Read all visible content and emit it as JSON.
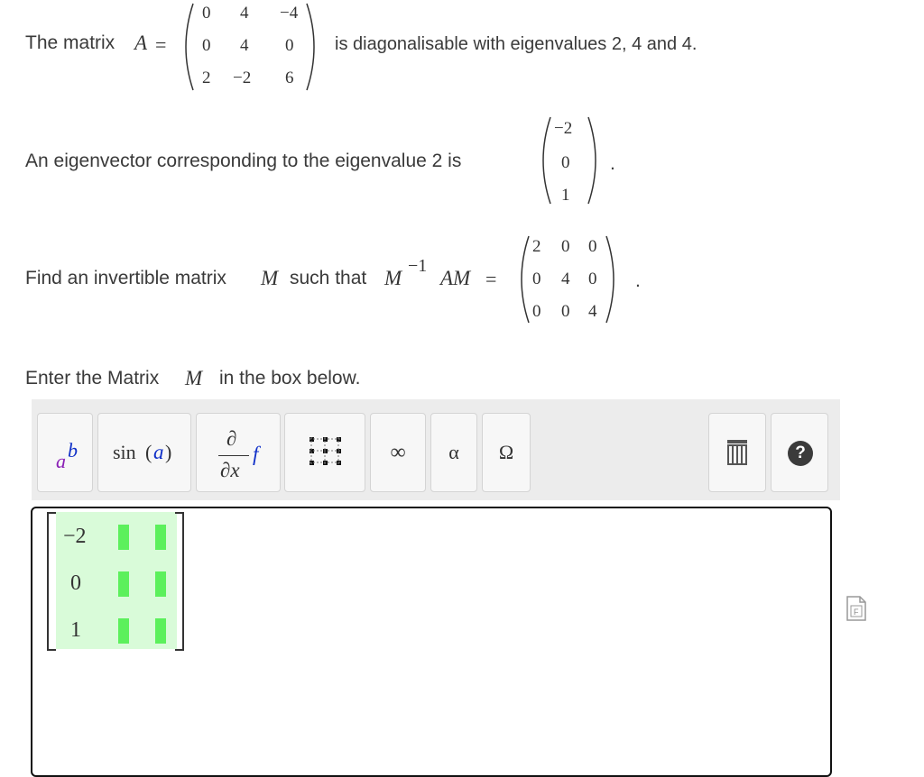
{
  "problem": {
    "line1_prefix": "The matrix",
    "matrix_symbol": "A",
    "equals": "=",
    "line1_suffix": "is diagonalisable with eigenvalues 2, 4 and 4.",
    "matrix_A": [
      [
        "0",
        "4",
        "−4"
      ],
      [
        "0",
        "4",
        "0"
      ],
      [
        "2",
        "−2",
        "6"
      ]
    ],
    "line2_text": "An eigenvector corresponding to the eigenvalue 2 is",
    "eigenvector": [
      "−2",
      "0",
      "1"
    ],
    "period": ".",
    "line3_prefix": "Find an invertible matrix",
    "line3_M": "M",
    "line3_mid": "such that",
    "line3_expr_M": "M",
    "line3_expr_sup": "−1",
    "line3_expr_AM": "AM",
    "line3_eq": "=",
    "diag_matrix": [
      [
        "2",
        "0",
        "0"
      ],
      [
        "0",
        "4",
        "0"
      ],
      [
        "0",
        "0",
        "4"
      ]
    ],
    "instruction_prefix": "Enter the Matrix",
    "instruction_M": "M",
    "instruction_suffix": "in the box below."
  },
  "toolbar": {
    "btn_power_base": "a",
    "btn_power_exp": "b",
    "btn_sin": "sin",
    "btn_sin_arg": "a",
    "btn_partial_num": "∂",
    "btn_partial_den": "∂x",
    "btn_partial_f": "f",
    "btn_infinity": "∞",
    "btn_alpha": "α",
    "btn_omega": "Ω",
    "btn_help": "?"
  },
  "editor": {
    "entries": [
      "−2",
      "0",
      "1"
    ]
  }
}
